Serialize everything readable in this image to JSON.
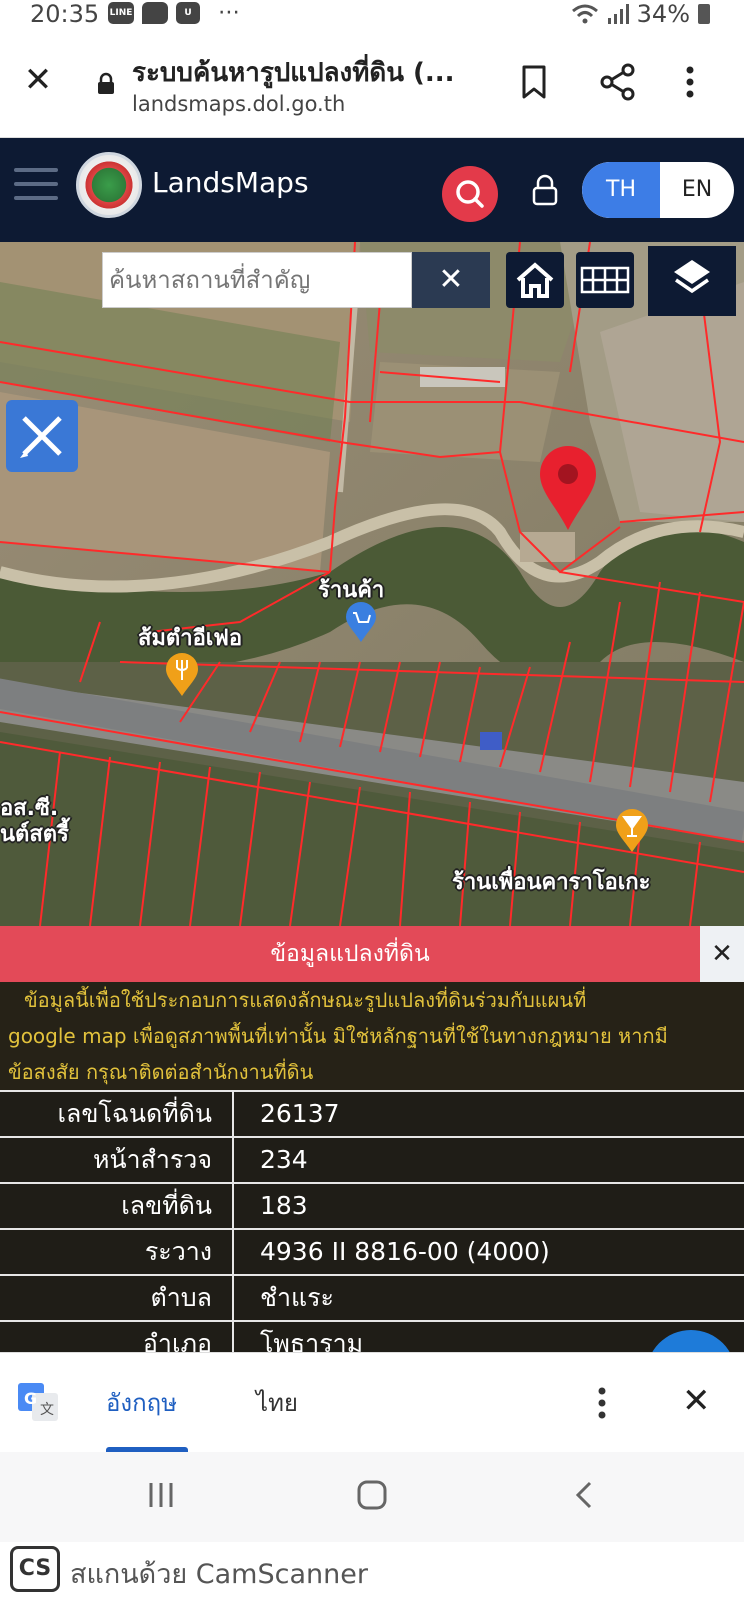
{
  "status_bar": {
    "time": "20:35",
    "battery": "34%",
    "icons": [
      "line-app-icon",
      "chat-icon",
      "u-app-icon",
      "more-dots-icon",
      "wifi-icon",
      "signal-icon",
      "battery-icon"
    ],
    "more": "⋯"
  },
  "browser": {
    "page_title": "ระบบค้นหารูปแปลงที่ดิน (...",
    "domain": "landsmaps.dol.go.th"
  },
  "header": {
    "brand": "LandsMaps",
    "lang_th": "TH",
    "lang_en": "EN",
    "active_lang": "TH"
  },
  "map": {
    "search_placeholder": "ค้นหาสถานที่สำคัญ",
    "labels": {
      "shop": "ร้านค้า",
      "somtam": "ส้มตำอีเฟอ",
      "karaoke": "ร้านเพื่อนคาราโอเกะ",
      "partial_1": "อส.ซี.",
      "partial_2": "นต์สตรี้"
    }
  },
  "info_panel": {
    "title": "ข้อมูลแปลงที่ดิน",
    "disclaimer": [
      "ข้อมูลนี้เพื่อใช้ประกอบการแสดงลักษณะรูปแปลงที่ดินร่วมกับแผนที่",
      "google map เพื่อดูสภาพพื้นที่เท่านั้น มิใช่หลักฐานที่ใช้ในทางกฎหมาย หากมี",
      "ข้อสงสัย กรุณาติดต่อสำนักงานที่ดิน"
    ],
    "rows": [
      {
        "key": "เลขโฉนดที่ดิน",
        "value": "26137"
      },
      {
        "key": "หน้าสำรวจ",
        "value": "234"
      },
      {
        "key": "เลขที่ดิน",
        "value": "183"
      },
      {
        "key": "ระวาง",
        "value": "4936 II 8816-00 (4000)"
      },
      {
        "key": "ตำบล",
        "value": "ชำแระ"
      },
      {
        "key": "อำเภอ",
        "value": "โพธาราม"
      }
    ]
  },
  "translate": {
    "tab_en": "อังกฤษ",
    "tab_th": "ไทย",
    "active_tab": "อังกฤษ"
  },
  "watermark": {
    "logo": "CS",
    "text": "สแกนด้วย CamScanner"
  },
  "colors": {
    "header_bg": "#0d1a33",
    "accent_red": "#e34a58",
    "parcel_line": "#ff2a2a",
    "disclaimer_text": "#e2c23c",
    "lang_active": "#3d7de6"
  }
}
